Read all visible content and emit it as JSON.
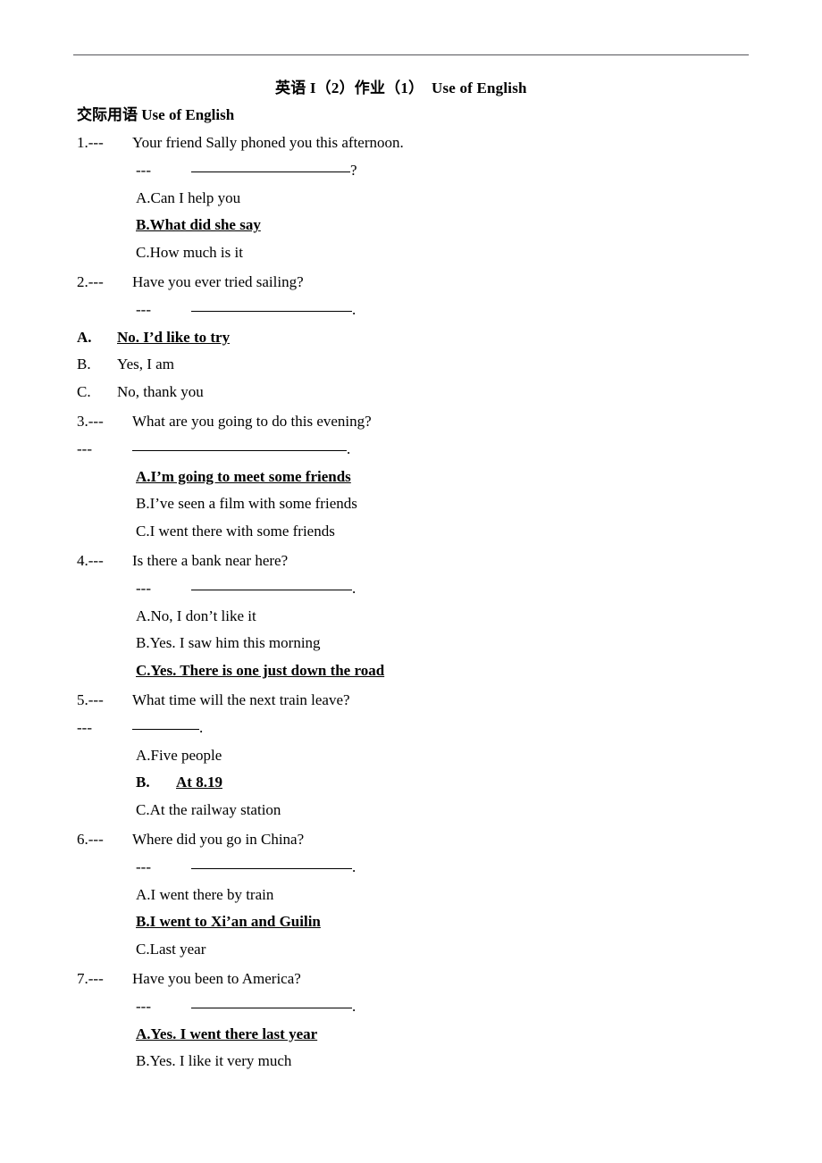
{
  "document": {
    "title": "英语 I（2）作业（1）　Use of English",
    "subtitle": "交际用语  Use of English",
    "dash_marker": "---",
    "period": ".",
    "question_mark": "?"
  },
  "questions": [
    {
      "number": "1.---",
      "prompt": "Your friend Sally phoned you this afternoon.",
      "answer_dash": "---",
      "blank_width": 178,
      "blank_terminator": "?",
      "blank_indent": "indent",
      "option_layout": "indent",
      "options": [
        {
          "label": "A.Can I help you",
          "correct": false
        },
        {
          "label": "B.What did she say",
          "correct": true
        },
        {
          "label": "C.How much is it",
          "correct": false
        }
      ]
    },
    {
      "number": "2.---",
      "prompt": "Have you ever tried sailing?",
      "answer_dash": "---",
      "blank_width": 180,
      "blank_terminator": ".",
      "blank_indent": "indent",
      "option_layout": "flush-tab",
      "options": [
        {
          "letter": "A.",
          "text": "No. I’d like to try",
          "correct": true
        },
        {
          "letter": "B.",
          "text": "Yes, I am",
          "correct": false
        },
        {
          "letter": "C.",
          "text": "No, thank you",
          "correct": false
        }
      ]
    },
    {
      "number": "3.---",
      "prompt": "What are you going to do this evening?",
      "answer_dash": "---",
      "blank_width": 240,
      "blank_terminator": ".",
      "blank_indent": "flush",
      "option_layout": "indent",
      "options": [
        {
          "label": "A.I’m going to meet some friends",
          "correct": true
        },
        {
          "label": "B.I’ve seen a film with some friends",
          "correct": false
        },
        {
          "label": "C.I went there with some friends",
          "correct": false
        }
      ]
    },
    {
      "number": "4.---",
      "prompt": "Is there a bank near here?",
      "answer_dash": "---",
      "blank_width": 180,
      "blank_terminator": ".",
      "blank_indent": "indent",
      "option_layout": "indent",
      "options": [
        {
          "label": "A.No, I don’t like it",
          "correct": false
        },
        {
          "label": "B.Yes. I saw him this morning",
          "correct": false
        },
        {
          "label": "C.Yes. There is one just down the road",
          "correct": true
        }
      ]
    },
    {
      "number": "5.---",
      "prompt": "What time will the next train leave?",
      "answer_dash": "---",
      "blank_width": 75,
      "blank_terminator": ".",
      "blank_indent": "flush",
      "option_layout": "mixed-tab",
      "options": [
        {
          "label": "A.Five people",
          "correct": false
        },
        {
          "letter": "B.",
          "text": "At 8.19",
          "correct": true
        },
        {
          "label": "C.At the railway station",
          "correct": false
        }
      ]
    },
    {
      "number": "6.---",
      "prompt": "Where did you go in China?",
      "answer_dash": "---",
      "blank_width": 180,
      "blank_terminator": ".",
      "blank_indent": "indent",
      "option_layout": "indent",
      "options": [
        {
          "label": "A.I went there by train",
          "correct": false
        },
        {
          "label": "B.I went to Xi’an and Guilin",
          "correct": true
        },
        {
          "label": "C.Last year",
          "correct": false
        }
      ]
    },
    {
      "number": "7.---",
      "prompt": "Have you been to America?",
      "answer_dash": "---",
      "blank_width": 180,
      "blank_terminator": ".",
      "blank_indent": "indent",
      "option_layout": "indent",
      "options": [
        {
          "label": "A.Yes. I went there last year",
          "correct": true
        },
        {
          "label": "B.Yes. I like it very much",
          "correct": false
        }
      ]
    }
  ]
}
